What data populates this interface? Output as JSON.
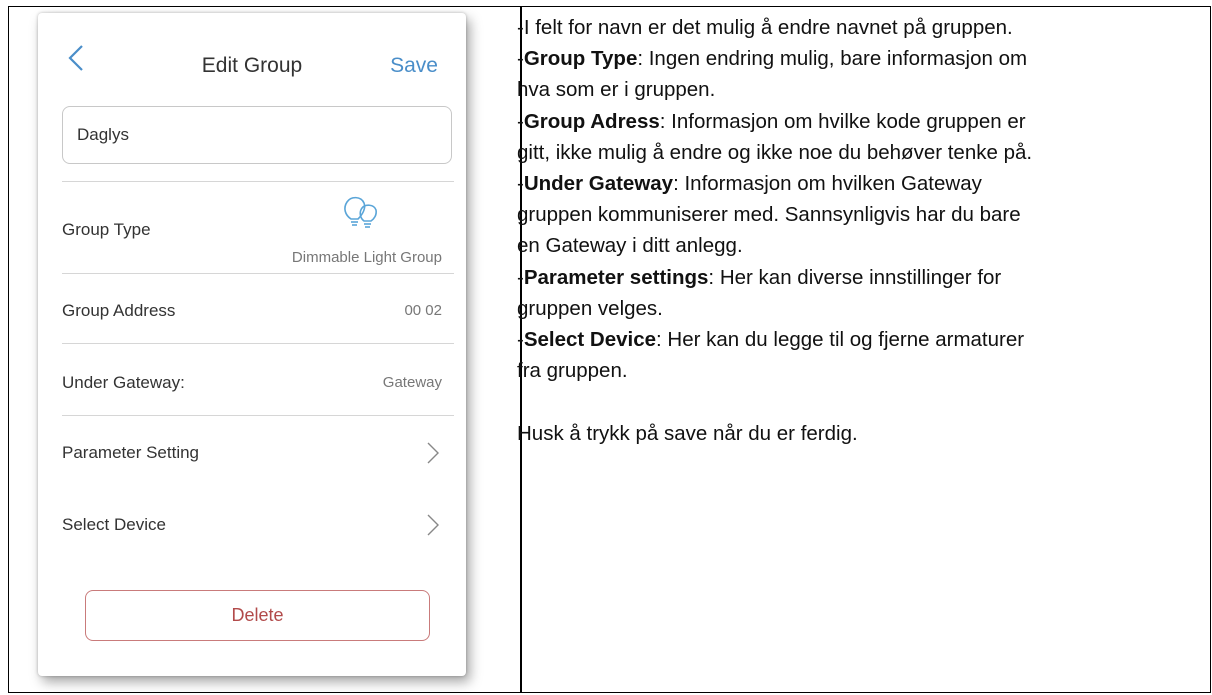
{
  "phone": {
    "header": {
      "title": "Edit Group",
      "save_label": "Save"
    },
    "name_field": {
      "value": "Daglys"
    },
    "rows": {
      "group_type": {
        "label": "Group Type",
        "value": "Dimmable Light Group"
      },
      "group_address": {
        "label": "Group Address",
        "value": "00 02"
      },
      "under_gateway": {
        "label": "Under Gateway:",
        "value": "Gateway"
      },
      "parameter_setting": {
        "label": "Parameter Setting"
      },
      "select_device": {
        "label": "Select Device"
      }
    },
    "delete_label": "Delete",
    "colors": {
      "accent": "#4a8ec9",
      "danger": "#b24a4a"
    }
  },
  "description": {
    "line1": "-I felt for navn er det mulig å endre navnet på gruppen.",
    "group_type_prefix": " -",
    "group_type_term": "Group Type",
    "group_type_text_1": ": Ingen endring mulig, bare informasjon om",
    "group_type_text_2": "hva som er i gruppen.",
    "group_adress_prefix": "-",
    "group_adress_term": "Group Adress",
    "group_adress_text_1": ": Informasjon om hvilke kode gruppen er",
    "group_adress_text_2": "gitt, ikke mulig å endre og ikke noe du behøver tenke på.",
    "under_gateway_prefix": "-",
    "under_gateway_term": "Under Gateway",
    "under_gateway_text_1": ": Informasjon om hvilken Gateway",
    "under_gateway_text_2": "gruppen kommuniserer med. Sannsynligvis har du bare",
    "under_gateway_text_3": "en Gateway i ditt anlegg.",
    "parameter_prefix": "-",
    "parameter_term": "Parameter settings",
    "parameter_text_1": ": Her kan diverse innstillinger for",
    "parameter_text_2": "gruppen velges.",
    "select_device_prefix": "-",
    "select_device_term": "Select Device",
    "select_device_text_1": ": Her kan du legge til og fjerne armaturer",
    "select_device_text_2": "fra gruppen.",
    "reminder": "Husk å trykk på save når du er ferdig."
  }
}
